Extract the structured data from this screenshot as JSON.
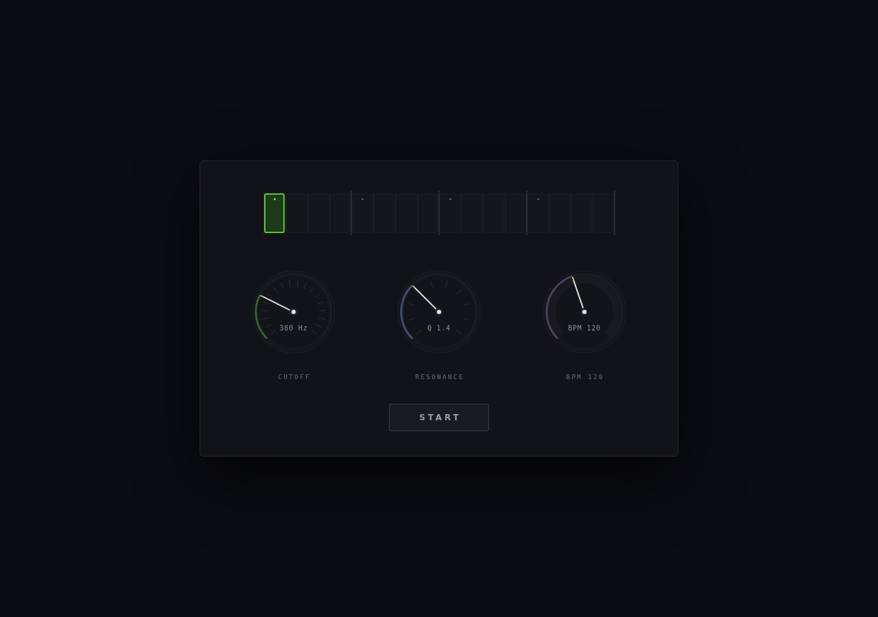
{
  "steps": [
    {
      "on": true
    },
    {
      "on": false
    },
    {
      "on": false
    },
    {
      "on": false
    },
    {
      "on": false
    },
    {
      "on": false
    },
    {
      "on": false
    },
    {
      "on": false
    },
    {
      "on": false
    },
    {
      "on": false
    },
    {
      "on": false
    },
    {
      "on": false
    },
    {
      "on": false
    },
    {
      "on": false
    },
    {
      "on": false
    },
    {
      "on": false
    }
  ],
  "dials": [
    {
      "kind": "fine",
      "label": "CUTOFF",
      "reading": "380 Hz",
      "level": 0.265,
      "color": "#335e2c"
    },
    {
      "kind": "coarse",
      "label": "RESONANCE",
      "reading": "Q 1.4",
      "level": 0.333,
      "color": "#3b4f72"
    },
    {
      "kind": "hatched",
      "label": "BPM 120",
      "reading": "BPM 120",
      "level": 0.43,
      "color": "#4b3d60"
    }
  ],
  "start_button": {
    "label": "START"
  }
}
